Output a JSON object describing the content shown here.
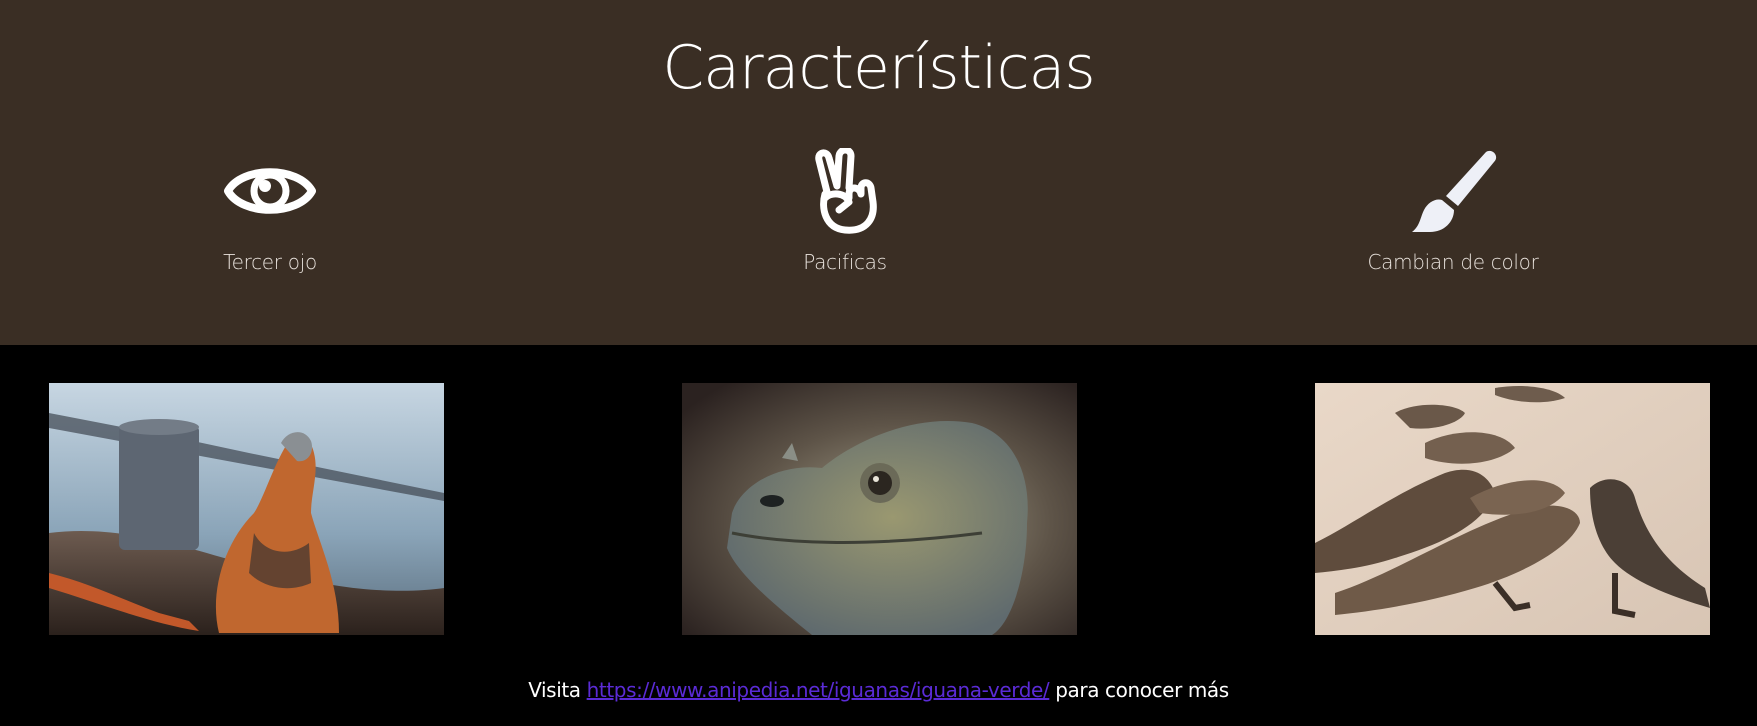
{
  "features": {
    "title": "Características",
    "items": [
      {
        "label": "Tercer ojo",
        "icon": "eye-icon"
      },
      {
        "label": "Pacificas",
        "icon": "peace-hand-icon"
      },
      {
        "label": "Cambian de color",
        "icon": "paintbrush-icon"
      }
    ],
    "background_color": "#3a2e24"
  },
  "gallery": {
    "images": [
      {
        "alt": "iguana-orange-on-shore"
      },
      {
        "alt": "iguana-head-closeup"
      },
      {
        "alt": "iguanas-on-sand"
      }
    ]
  },
  "footer": {
    "prefix": "Visita",
    "link_text": "https://www.anipedia.net/iguanas/iguana-verde/",
    "suffix": "para conocer más",
    "link_color": "#5b2bd6"
  }
}
